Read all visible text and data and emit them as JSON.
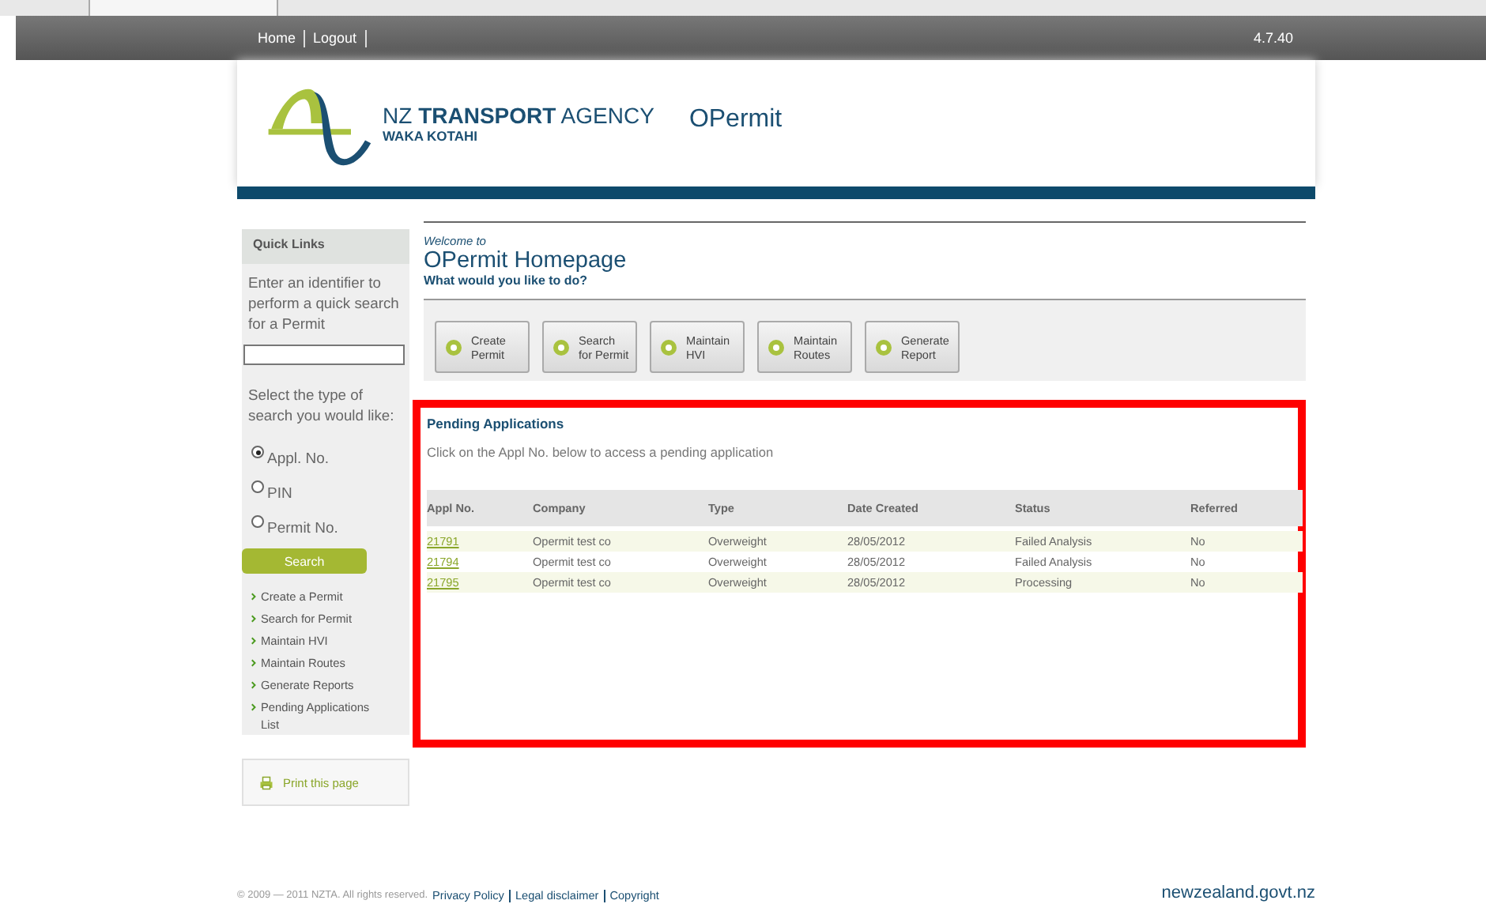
{
  "topbar": {
    "nav_links": [
      "Home",
      "Logout"
    ],
    "version": "4.7.40"
  },
  "header": {
    "brand_name": "NZ **TRANSPORT** AGENCY",
    "brand_sub": "WAKA KOTAHI",
    "app_title": "OPermit"
  },
  "sidebar": {
    "title": "Quick Links",
    "prompt": "Enter an identifier to perform a quick search for a Permit",
    "type_prompt": "Select the type of search you would like:",
    "search_types": [
      {
        "label": "Appl. No.",
        "selected": true
      },
      {
        "label": "PIN",
        "selected": false
      },
      {
        "label": "Permit No.",
        "selected": false
      }
    ],
    "search_button": "Search",
    "links": [
      "Create a Permit",
      "Search for Permit",
      "Maintain HVI",
      "Maintain Routes",
      "Generate Reports",
      "Pending Applications List"
    ],
    "print_link": "Print this page"
  },
  "main": {
    "welcome": "Welcome to",
    "title": "OPermit Homepage",
    "question": "What would you like to do?",
    "actions": [
      "Create\nPermit",
      "Search\nfor Permit",
      "Maintain\nHVI",
      "Maintain\nRoutes",
      "Generate\nReport"
    ]
  },
  "pending": {
    "title": "Pending Applications",
    "hint": "Click on the Appl No. below to access a pending application",
    "columns": [
      "Appl No.",
      "Company",
      "Type",
      "Date Created",
      "Status",
      "Referred"
    ],
    "rows": [
      {
        "cells": [
          "21791",
          "Opermit test co",
          "Overweight",
          "28/05/2012",
          "Failed Analysis",
          "No"
        ]
      },
      {
        "cells": [
          "21794",
          "Opermit test co",
          "Overweight",
          "28/05/2012",
          "Failed Analysis",
          "No"
        ]
      },
      {
        "cells": [
          "21795",
          "Opermit test co",
          "Overweight",
          "28/05/2012",
          "Processing",
          "No"
        ]
      }
    ]
  },
  "footer": {
    "copyright": "© 2009 — 2011 NZTA. All rights reserved.",
    "links": [
      "Privacy Policy",
      "Legal disclaimer",
      "Copyright"
    ],
    "govt": "newzealand.govt.nz"
  }
}
